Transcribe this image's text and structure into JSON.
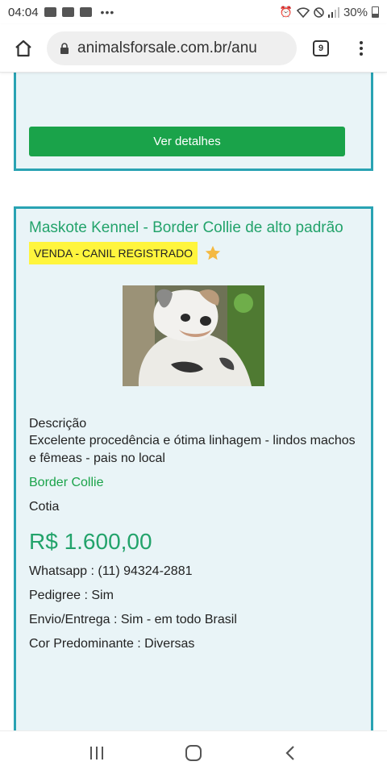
{
  "status_bar": {
    "time": "04:04",
    "dots": "•••",
    "battery": "30%"
  },
  "browser": {
    "url": "animalsforsale.com.br/anu",
    "tab_count": "9"
  },
  "previous_card": {
    "details_button": "Ver detalhes"
  },
  "listing": {
    "title": "Maskote Kennel - Border Collie de alto padrão",
    "badge": "VENDA - CANIL REGISTRADO",
    "description_label": "Descrição",
    "description": "Excelente procedência e ótima linhagem - lindos machos e fêmeas - pais no local",
    "breed": "Border Collie",
    "city": "Cotia",
    "price": "R$ 1.600,00",
    "whatsapp": "Whatsapp : (11) 94324-2881",
    "pedigree": "Pedigree : Sim",
    "shipping": "Envio/Entrega : Sim - em todo Brasil",
    "color": "Cor Predominante : Diversas"
  },
  "colors": {
    "accent_green": "#1aa34a",
    "title_green": "#23a36b",
    "card_border": "#29a3b3",
    "card_bg": "#e9f4f7",
    "badge_yellow": "#fff53d",
    "star": "#f4b942"
  },
  "icons": {
    "home": "home-icon",
    "lock": "lock-icon",
    "menu": "more-vert-icon",
    "star": "star-icon",
    "nav_recents": "recents-icon",
    "nav_home": "nav-home-icon",
    "nav_back": "back-icon"
  }
}
